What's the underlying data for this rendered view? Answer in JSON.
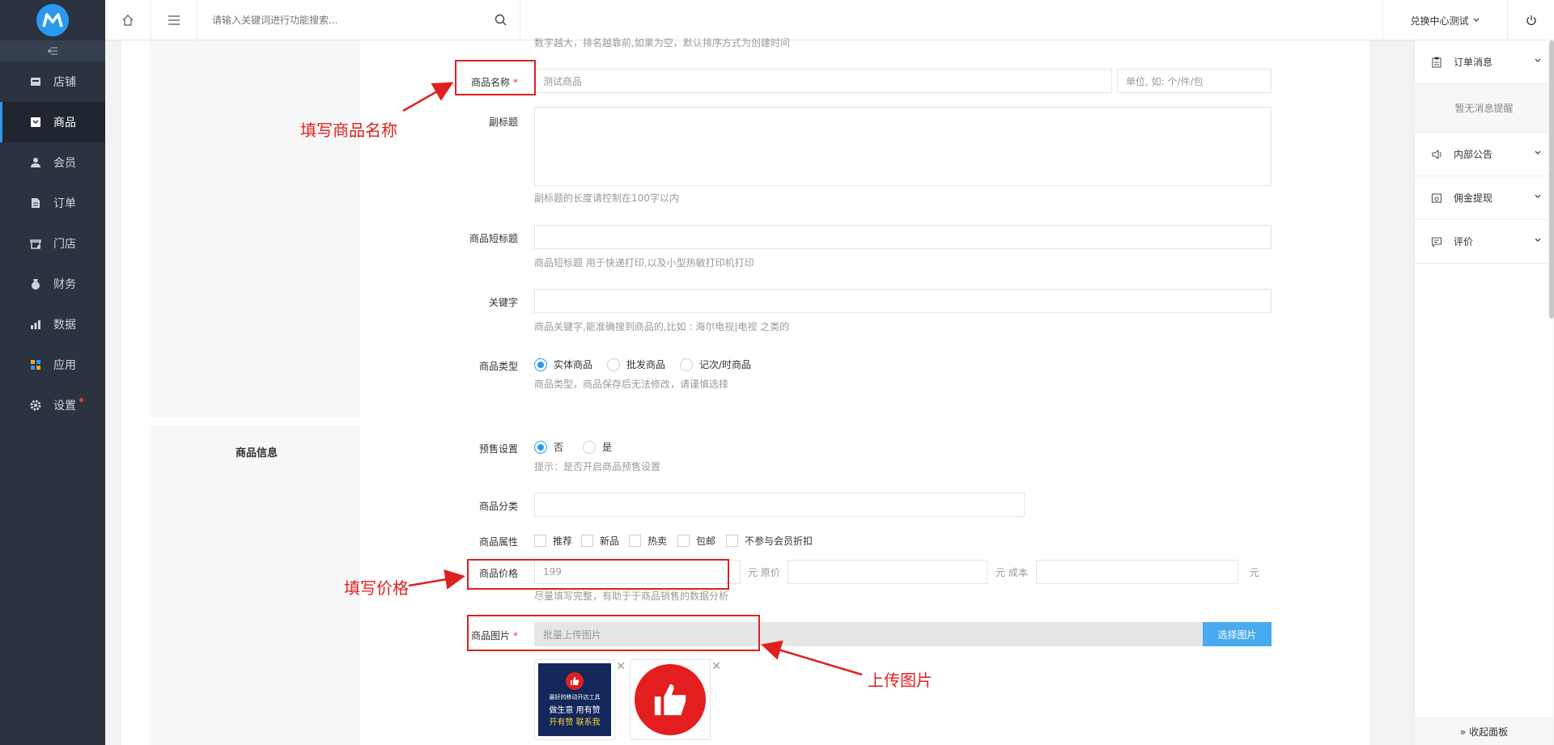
{
  "sidebar": {
    "collapse_icon": "collapse-icon",
    "items": [
      {
        "label": "店铺",
        "icon": "store-icon"
      },
      {
        "label": "商品",
        "icon": "goods-icon",
        "active": true
      },
      {
        "label": "会员",
        "icon": "member-icon"
      },
      {
        "label": "订单",
        "icon": "order-icon"
      },
      {
        "label": "门店",
        "icon": "shop-icon"
      },
      {
        "label": "财务",
        "icon": "finance-icon"
      },
      {
        "label": "数据",
        "icon": "data-icon"
      },
      {
        "label": "应用",
        "icon": "apps-icon"
      },
      {
        "label": "设置",
        "icon": "settings-icon"
      }
    ]
  },
  "topbar": {
    "search_placeholder": "请输入关键词进行功能搜索...",
    "store_name": "兑换中心测试"
  },
  "form": {
    "top_hint": "数字越大，排名越靠前,如果为空，默认排序方式为创建时间",
    "name_label": "商品名称",
    "name_value": "测试商品",
    "unit_placeholder": "单位, 如: 个/件/包",
    "subtitle_label": "副标题",
    "subtitle_hint": "副标题的长度请控制在100字以内",
    "short_title_label": "商品短标题",
    "short_title_hint": "商品短标题 用于快递打印,以及小型热敏打印机打印",
    "keywords_label": "关键字",
    "keywords_hint": "商品关键字,能准确搜到商品的,比如 : 海尔电视|电视 之类的",
    "type_label": "商品类型",
    "type_options": [
      "实体商品",
      "批发商品",
      "记次/时商品"
    ],
    "type_hint": "商品类型，商品保存后无法修改，请谨慎选择",
    "info_section_title": "商品信息",
    "presale_label": "预售设置",
    "presale_options": [
      "否",
      "是"
    ],
    "presale_hint": "提示：是否开启商品预售设置",
    "category_label": "商品分类",
    "attr_label": "商品属性",
    "attr_options": [
      "推荐",
      "新品",
      "热卖",
      "包邮",
      "不参与会员折扣"
    ],
    "price_label": "商品价格",
    "price_value": "199",
    "price_units": [
      "元 原价",
      "元 成本",
      "元"
    ],
    "price_hint": "尽量填写完整，有助于于商品销售的数据分析",
    "image_label": "商品图片",
    "image_placeholder": "批量上传图片",
    "image_button": "选择图片",
    "thumb1_line1": "最好的移动开店工具",
    "thumb1_line2": "做生意 用有赞",
    "thumb1_line3": "开有赞 联系我"
  },
  "annotations": {
    "name": "填写商品名称",
    "price": "填写价格",
    "image": "上传图片"
  },
  "right_panel": {
    "items": [
      {
        "label": "订单消息",
        "icon": "clipboard-icon"
      },
      {
        "label": "内部公告",
        "icon": "speaker-icon"
      },
      {
        "label": "佣金提现",
        "icon": "wallet-icon"
      },
      {
        "label": "评价",
        "icon": "comment-icon"
      }
    ],
    "empty_text": "暂无消息提醒",
    "footer": "» 收起面板"
  },
  "colors": {
    "accent": "#2a9af0",
    "sidebar_bg": "#2b3340",
    "annotation_red": "#e02020"
  }
}
